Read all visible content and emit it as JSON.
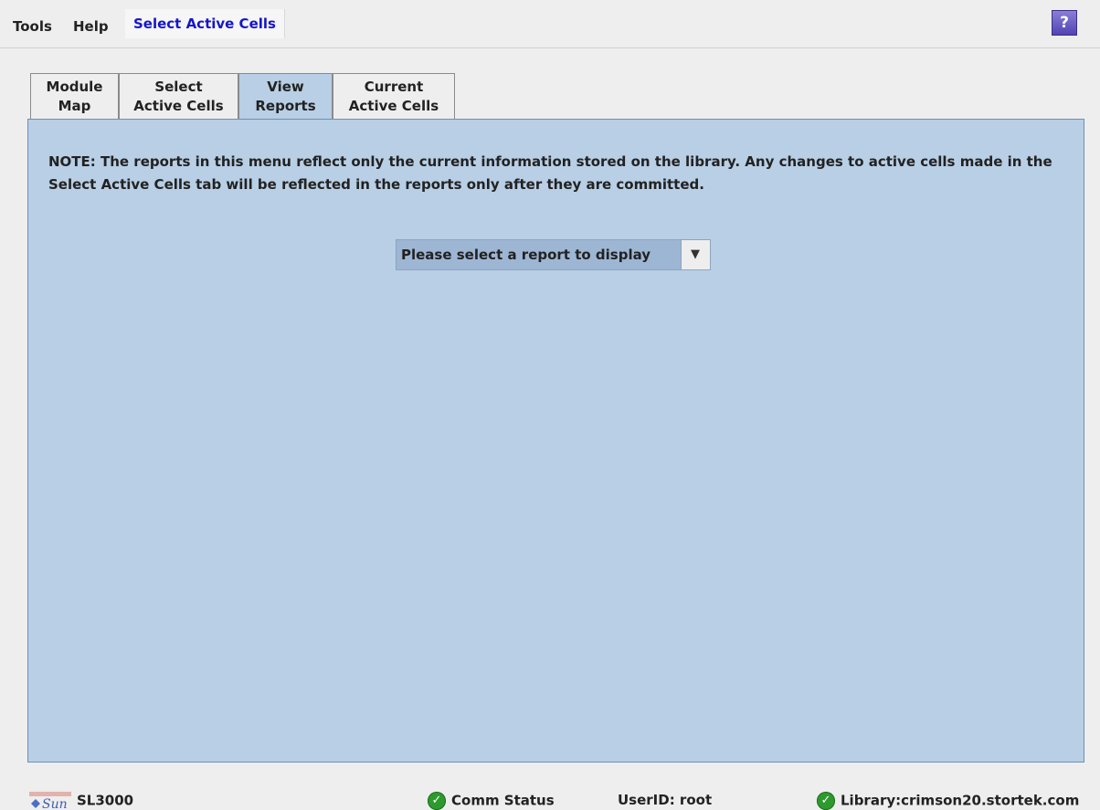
{
  "menubar": {
    "items": [
      "Tools",
      "Help"
    ],
    "active_item": "Select Active Cells",
    "help_icon": "?"
  },
  "tabs": [
    {
      "line1": "Module",
      "line2": "Map"
    },
    {
      "line1": "Select",
      "line2": "Active Cells"
    },
    {
      "line1": "View",
      "line2": "Reports",
      "selected": true
    },
    {
      "line1": "Current",
      "line2": "Active Cells"
    }
  ],
  "panel": {
    "note": "NOTE: The reports in this menu reflect only the current information stored on the library. Any changes to active cells made in the Select Active Cells tab will be reflected in the reports only after they are committed.",
    "report_select": {
      "value": "Please select a report to display",
      "icon": "dropdown-arrow"
    }
  },
  "statusbar": {
    "product": "SL3000",
    "logo_text": "Sun",
    "comm_status": "Comm Status",
    "user": "UserID: root",
    "library": "Library:crimson20.stortek.com"
  },
  "colors": {
    "panel_bg": "#b8cfe5",
    "active_menu": "#1515cc",
    "status_ok": "#2e9a2e"
  }
}
